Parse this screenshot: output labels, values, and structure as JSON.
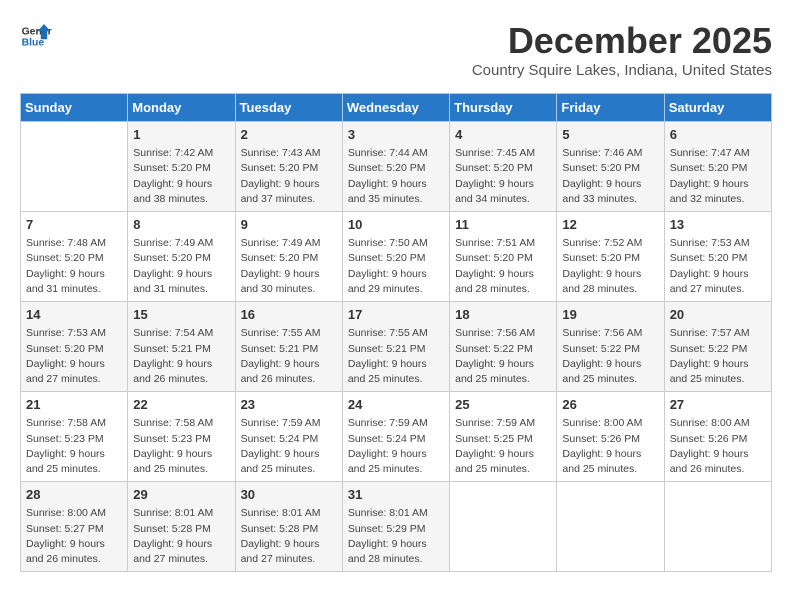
{
  "logo": {
    "line1": "General",
    "line2": "Blue"
  },
  "title": "December 2025",
  "subtitle": "Country Squire Lakes, Indiana, United States",
  "days_of_week": [
    "Sunday",
    "Monday",
    "Tuesday",
    "Wednesday",
    "Thursday",
    "Friday",
    "Saturday"
  ],
  "weeks": [
    [
      {
        "day": "",
        "info": ""
      },
      {
        "day": "1",
        "info": "Sunrise: 7:42 AM\nSunset: 5:20 PM\nDaylight: 9 hours\nand 38 minutes."
      },
      {
        "day": "2",
        "info": "Sunrise: 7:43 AM\nSunset: 5:20 PM\nDaylight: 9 hours\nand 37 minutes."
      },
      {
        "day": "3",
        "info": "Sunrise: 7:44 AM\nSunset: 5:20 PM\nDaylight: 9 hours\nand 35 minutes."
      },
      {
        "day": "4",
        "info": "Sunrise: 7:45 AM\nSunset: 5:20 PM\nDaylight: 9 hours\nand 34 minutes."
      },
      {
        "day": "5",
        "info": "Sunrise: 7:46 AM\nSunset: 5:20 PM\nDaylight: 9 hours\nand 33 minutes."
      },
      {
        "day": "6",
        "info": "Sunrise: 7:47 AM\nSunset: 5:20 PM\nDaylight: 9 hours\nand 32 minutes."
      }
    ],
    [
      {
        "day": "7",
        "info": "Sunrise: 7:48 AM\nSunset: 5:20 PM\nDaylight: 9 hours\nand 31 minutes."
      },
      {
        "day": "8",
        "info": "Sunrise: 7:49 AM\nSunset: 5:20 PM\nDaylight: 9 hours\nand 31 minutes."
      },
      {
        "day": "9",
        "info": "Sunrise: 7:49 AM\nSunset: 5:20 PM\nDaylight: 9 hours\nand 30 minutes."
      },
      {
        "day": "10",
        "info": "Sunrise: 7:50 AM\nSunset: 5:20 PM\nDaylight: 9 hours\nand 29 minutes."
      },
      {
        "day": "11",
        "info": "Sunrise: 7:51 AM\nSunset: 5:20 PM\nDaylight: 9 hours\nand 28 minutes."
      },
      {
        "day": "12",
        "info": "Sunrise: 7:52 AM\nSunset: 5:20 PM\nDaylight: 9 hours\nand 28 minutes."
      },
      {
        "day": "13",
        "info": "Sunrise: 7:53 AM\nSunset: 5:20 PM\nDaylight: 9 hours\nand 27 minutes."
      }
    ],
    [
      {
        "day": "14",
        "info": "Sunrise: 7:53 AM\nSunset: 5:20 PM\nDaylight: 9 hours\nand 27 minutes."
      },
      {
        "day": "15",
        "info": "Sunrise: 7:54 AM\nSunset: 5:21 PM\nDaylight: 9 hours\nand 26 minutes."
      },
      {
        "day": "16",
        "info": "Sunrise: 7:55 AM\nSunset: 5:21 PM\nDaylight: 9 hours\nand 26 minutes."
      },
      {
        "day": "17",
        "info": "Sunrise: 7:55 AM\nSunset: 5:21 PM\nDaylight: 9 hours\nand 25 minutes."
      },
      {
        "day": "18",
        "info": "Sunrise: 7:56 AM\nSunset: 5:22 PM\nDaylight: 9 hours\nand 25 minutes."
      },
      {
        "day": "19",
        "info": "Sunrise: 7:56 AM\nSunset: 5:22 PM\nDaylight: 9 hours\nand 25 minutes."
      },
      {
        "day": "20",
        "info": "Sunrise: 7:57 AM\nSunset: 5:22 PM\nDaylight: 9 hours\nand 25 minutes."
      }
    ],
    [
      {
        "day": "21",
        "info": "Sunrise: 7:58 AM\nSunset: 5:23 PM\nDaylight: 9 hours\nand 25 minutes."
      },
      {
        "day": "22",
        "info": "Sunrise: 7:58 AM\nSunset: 5:23 PM\nDaylight: 9 hours\nand 25 minutes."
      },
      {
        "day": "23",
        "info": "Sunrise: 7:59 AM\nSunset: 5:24 PM\nDaylight: 9 hours\nand 25 minutes."
      },
      {
        "day": "24",
        "info": "Sunrise: 7:59 AM\nSunset: 5:24 PM\nDaylight: 9 hours\nand 25 minutes."
      },
      {
        "day": "25",
        "info": "Sunrise: 7:59 AM\nSunset: 5:25 PM\nDaylight: 9 hours\nand 25 minutes."
      },
      {
        "day": "26",
        "info": "Sunrise: 8:00 AM\nSunset: 5:26 PM\nDaylight: 9 hours\nand 25 minutes."
      },
      {
        "day": "27",
        "info": "Sunrise: 8:00 AM\nSunset: 5:26 PM\nDaylight: 9 hours\nand 26 minutes."
      }
    ],
    [
      {
        "day": "28",
        "info": "Sunrise: 8:00 AM\nSunset: 5:27 PM\nDaylight: 9 hours\nand 26 minutes."
      },
      {
        "day": "29",
        "info": "Sunrise: 8:01 AM\nSunset: 5:28 PM\nDaylight: 9 hours\nand 27 minutes."
      },
      {
        "day": "30",
        "info": "Sunrise: 8:01 AM\nSunset: 5:28 PM\nDaylight: 9 hours\nand 27 minutes."
      },
      {
        "day": "31",
        "info": "Sunrise: 8:01 AM\nSunset: 5:29 PM\nDaylight: 9 hours\nand 28 minutes."
      },
      {
        "day": "",
        "info": ""
      },
      {
        "day": "",
        "info": ""
      },
      {
        "day": "",
        "info": ""
      }
    ]
  ]
}
